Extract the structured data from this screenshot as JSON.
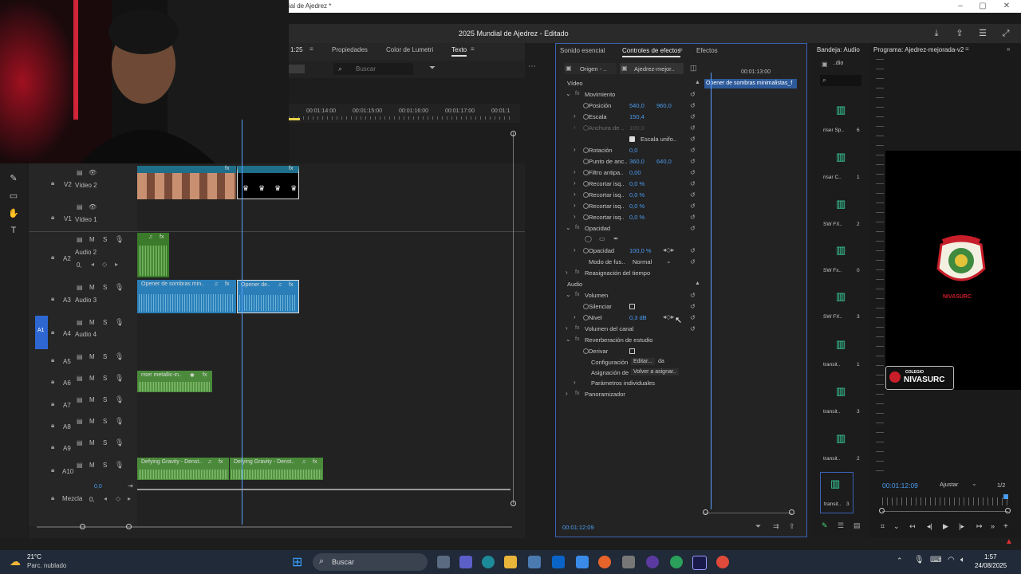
{
  "window": {
    "title": "ial de Ajedrez *",
    "project_title": "2025 Mundial de Ajedrez - Editado"
  },
  "timeline": {
    "timecode_left": "1:25",
    "tabs": [
      "Propiedades",
      "Color de Lumetri",
      "Texto"
    ],
    "search_placeholder": "Buscar",
    "ruler": [
      "00:01:14:00",
      "00:01:15:00",
      "00:01:16:00",
      "00:01:17:00",
      "00:01:1"
    ],
    "tracks": [
      {
        "id": "V2",
        "name": "Vídeo 2"
      },
      {
        "id": "V1",
        "name": "Vídeo 1"
      },
      {
        "id": "A2",
        "name": "Audio 2"
      },
      {
        "id": "A3",
        "name": "Audio 3"
      },
      {
        "id": "A4",
        "name": "Audio 4"
      },
      {
        "id": "A5",
        "name": ""
      },
      {
        "id": "A6",
        "name": ""
      },
      {
        "id": "A7",
        "name": ""
      },
      {
        "id": "A8",
        "name": ""
      },
      {
        "id": "A9",
        "name": ""
      },
      {
        "id": "A10",
        "name": ""
      }
    ],
    "a1_label": "A1",
    "a2_value": "0,",
    "mix_label": "Mezcla",
    "mix_value": "0,0",
    "mix_zero": "0,",
    "clips": {
      "a3_clip1": "Opener de sombras min..",
      "a3_clip2": "Opener de..",
      "a6_clip": "riser metallic-in..",
      "a10_clip1": "Defying Gravity - Denst..",
      "a10_clip2": "Defying Gravity - Denst.."
    },
    "track_letters": {
      "m": "M",
      "s": "S"
    }
  },
  "effects": {
    "tabs": [
      "Sonido esencial",
      "Controles de efectos",
      "Efectos"
    ],
    "source": "Origen - ..",
    "sequence": "Ajedrez-mejor..",
    "mini_timecode": "00:01:13:00",
    "clip_label": "Opener de sombras minimalistas_f",
    "sections": {
      "video": "Vídeo",
      "audio": "Audio"
    },
    "rows": {
      "movimiento": "Movimiento",
      "posicion": {
        "label": "Posición",
        "v1": "540,0",
        "v2": "960,0"
      },
      "escala": {
        "label": "Escala",
        "v1": "150,4"
      },
      "anchura": {
        "label": "Anchura de ..",
        "v1": "100,0"
      },
      "escala_unif": "Escala unifo..",
      "rotacion": {
        "label": "Rotación",
        "v1": "0,0"
      },
      "punto": {
        "label": "Punto de anc..",
        "v1": "360,0",
        "v2": "640,0"
      },
      "filtro": {
        "label": "Filtro antipa..",
        "v1": "0,00"
      },
      "recortar1": {
        "label": "Recortar isq..",
        "v1": "0,0 %"
      },
      "recortar2": {
        "label": "Recortar isq..",
        "v1": "0,0 %"
      },
      "recortar3": {
        "label": "Recortar isq..",
        "v1": "0,0 %"
      },
      "recortar4": {
        "label": "Recortar isq..",
        "v1": "0,0 %"
      },
      "opacidad_h": "Opacidad",
      "opacidad": {
        "label": "Opacidad",
        "v1": "100,0 %"
      },
      "modo": {
        "label": "Modo de fus..",
        "v1": "Normal"
      },
      "reasignacion": "Reasignación del tiempo",
      "volumen": "Volumen",
      "silenciar": "Silenciar",
      "nivel": {
        "label": "Nivel",
        "v1": "0,3 dB"
      },
      "volumen_canal": "Volumen del canal",
      "reverb": "Reverberación de estudio",
      "derivar": "Derivar",
      "config": {
        "label": "Configuración",
        "v1": "Editar...",
        "v2": "da"
      },
      "asignacion": {
        "label": "Asignación de",
        "v1": "Volver a asignar.."
      },
      "param": "Parámetros individuales",
      "panoramizador": "Panoramizador"
    },
    "timecode": "00:01:12:09"
  },
  "bin": {
    "title": "Bandeja: Audio",
    "items": [
      {
        "name": "riser Sp..",
        "n": "6"
      },
      {
        "name": "risar C..",
        "n": "1"
      },
      {
        "name": "SW FX..",
        "n": "2"
      },
      {
        "name": "SW Fx..",
        "n": "0"
      },
      {
        "name": "SW FX..",
        "n": "3"
      },
      {
        "name": "transit..",
        "n": "1"
      },
      {
        "name": "transit..",
        "n": "3"
      },
      {
        "name": "transit..",
        "n": "2"
      },
      {
        "name": "transit..",
        "n": "3"
      }
    ],
    "dio": "..dio"
  },
  "program": {
    "title": "Programa: Ajedrez-mejorada-v2",
    "timecode": "00:01:12:09",
    "fit": "Ajustar",
    "ratio": "1/2",
    "school_line1": "COLEGIO",
    "school_line2": "NIVASURC",
    "logo_text": "NIVASURC"
  },
  "taskbar": {
    "weather_temp": "21°C",
    "weather_desc": "Parc. nublado",
    "search": "Buscar",
    "time": "1:57",
    "date": "24/08/2025"
  },
  "colors": {
    "accent": "#3a62b4",
    "value_blue": "#4b9cf0",
    "audio_clip": "#2a7fb8",
    "green_clip": "#4a8a3a"
  }
}
